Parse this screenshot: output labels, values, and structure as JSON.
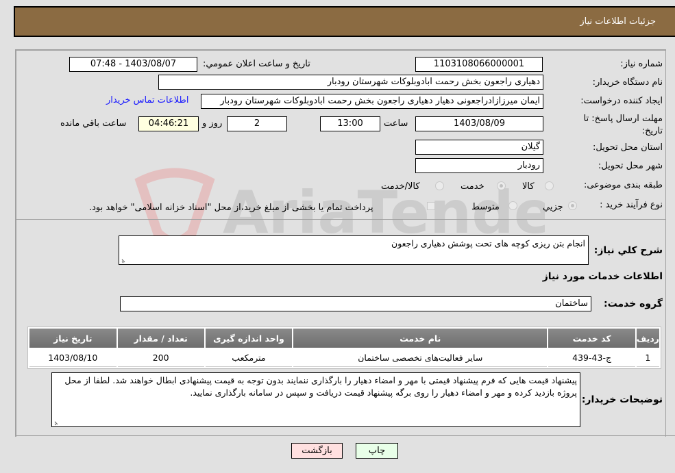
{
  "header": {
    "title": "جزئیات اطلاعات نیاز"
  },
  "fields": {
    "need_number": {
      "label": "شماره نیاز:",
      "value": "1103108066000001"
    },
    "announce_datetime": {
      "label": "تاریخ و ساعت اعلان عمومي:",
      "value": "1403/08/07 - 07:48"
    },
    "buyer_org": {
      "label": "نام دستگاه خريدار:",
      "value": "دهیاری راجعون بخش رحمت ابادوبلوکات شهرستان رودبار"
    },
    "requester": {
      "label": "ایجاد کننده درخواست:",
      "value": "ایمان میرزازادراجعونی دهیار دهیاری راجعون بخش رحمت ابادوبلوکات شهرستان رودبار"
    },
    "buyer_contact_link": "اطلاعات تماس خريدار",
    "deadline": {
      "label": "مهلت ارسال پاسخ: تا تاریخ:",
      "date": "1403/08/09",
      "time_label": "ساعت",
      "time": "13:00",
      "days": "2",
      "days_label": "روز و",
      "remaining": "04:46:21",
      "remaining_label": "ساعت باقي مانده"
    },
    "province": {
      "label": "استان محل تحویل:",
      "value": "گيلان"
    },
    "city": {
      "label": "شهر محل تحویل:",
      "value": "رودبار"
    },
    "category": {
      "label": "طبقه بندی موضوعی:",
      "options": [
        "کالا",
        "خدمت",
        "کالا/خدمت"
      ],
      "selected": "خدمت"
    },
    "purchase_type": {
      "label": "نوع فرآیند خرید :",
      "options": [
        "جزيي",
        "متوسط"
      ],
      "selected": "جزيي",
      "treasury_checkbox_label": "پرداخت تمام یا بخشی از مبلغ خرید،از محل \"اسناد خزانه اسلامی\" خواهد بود.",
      "treasury_checked": false
    }
  },
  "description": {
    "label": "شرح کلي نياز:",
    "value": "انجام  بتن ریزی کوچه های تحت پوشش دهیاری راجعون"
  },
  "services_section": {
    "title": "اطلاعات خدمات مورد نياز",
    "group_label": "گروه خدمت:",
    "group_value": "ساختمان",
    "table": {
      "columns": [
        "رديف",
        "کد خدمت",
        "نام خدمت",
        "واحد اندازه گيری",
        "تعداد / مقدار",
        "تاريخ نياز"
      ],
      "rows": [
        [
          "1",
          "ج-43-439",
          "سایر فعالیت‌های تخصصی ساختمان",
          "مترمكعب",
          "200",
          "1403/08/10"
        ]
      ]
    }
  },
  "buyer_notes": {
    "label": "توضيحات خريدار:",
    "value": "پیشنهاد قیمت هایی که فرم پیشنهاد قیمتی با مهر و امضاء دهیار را بارگذاری ننمایند بدون توجه به قیمت پیشنهادی ابطال خواهند شد. لطفا از محل پروژه بازدید کرده و مهر و امضاء دهیار را روی برگه پیشنهاد قیمت دریافت و سپس در سامانه بارگذاری نمایید."
  },
  "buttons": {
    "print": "چاپ",
    "back": "بازگشت"
  },
  "watermark": {
    "text": "AriaTender.neT"
  },
  "colors": {
    "header_bg": "#8b6b42",
    "link": "#1a1aff",
    "back_btn": "#ffe0e0",
    "print_btn": "#e8ffe8",
    "remaining_bg": "#ffffe0"
  }
}
